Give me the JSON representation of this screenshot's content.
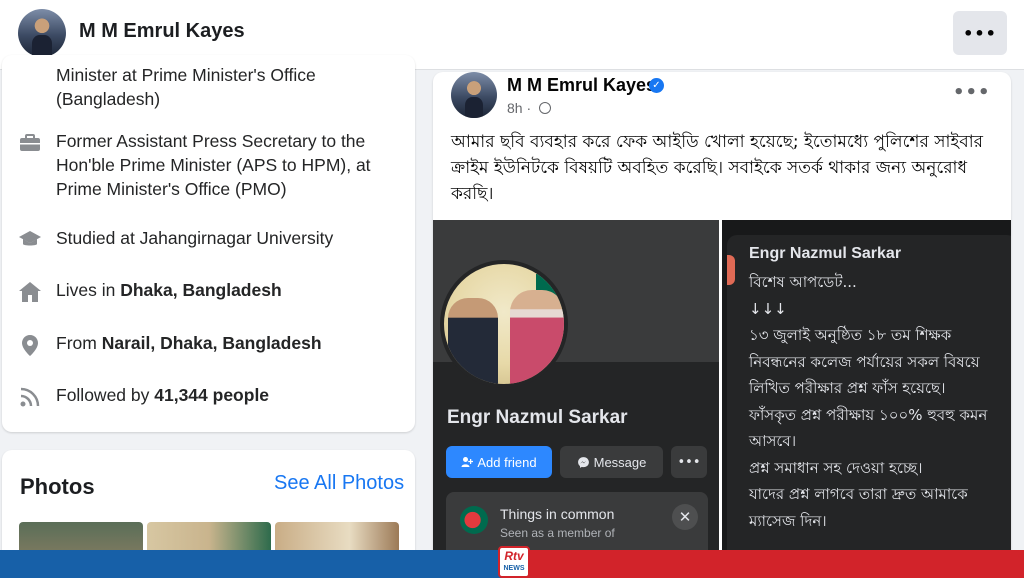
{
  "header": {
    "name": "M M Emrul Kayes",
    "more_label": "•••"
  },
  "intro": {
    "role_partial": "Minister at Prime Minister's Office (Bangladesh)",
    "work": "Former Assistant Press Secretary to the Hon'ble Prime Minister (APS to HPM), at Prime Minister's Office (PMO)",
    "education_prefix": "Studied at ",
    "education_value": "Jahangirnagar University",
    "lives_prefix": "Lives in ",
    "lives_value": "Dhaka, Bangladesh",
    "from_prefix": "From ",
    "from_value": "Narail, Dhaka, Bangladesh",
    "followed_prefix": "Followed by ",
    "followed_value": "41,344 people"
  },
  "photos": {
    "title": "Photos",
    "see_all": "See All Photos"
  },
  "post": {
    "author": "M M Emrul Kayes",
    "verified_mark": "✓",
    "time": "8h",
    "more_label": "•••",
    "text": "আমার ছবি ব্যবহার করে ফেক আইডি খোলা হয়েছে; ইতোমধ্যে পুলিশের সাইবার ক্রাইম ইউনিটকে বিষয়টি অবহিত করেছি। সবাইকে সতর্ক থাকার জন্য অনুরোধ করছি।"
  },
  "fake_profile": {
    "name": "Engr Nazmul Sarkar",
    "add_friend": "Add friend",
    "message": "Message",
    "more": "•••",
    "common_title": "Things in common",
    "common_sub": "Seen as a member of",
    "close": "✕"
  },
  "fake_post": {
    "name": "Engr Nazmul Sarkar",
    "lines": [
      "বিশেষ আপডেট...",
      "↓↓↓",
      "১৩ জুলাই অনুষ্ঠিত ১৮ তম শিক্ষক",
      "নিবন্ধনের কলেজ পর্যায়ের সকল বিষয়ে",
      "লিখিত পরীক্ষার প্রশ্ন ফাঁস হয়েছে।",
      "ফাঁসকৃত প্রশ্ন পরীক্ষায় ১০০% হুবহু কমন",
      "আসবে।",
      "প্রশ্ন সমাধান সহ দেওয়া হচ্ছে।",
      "যাদের প্রশ্ন লাগবে তারা দ্রুত আমাকে",
      "ম্যাসেজ দিন।"
    ]
  },
  "watermark": {
    "logo": "Rtv",
    "sub": "NEWS"
  }
}
